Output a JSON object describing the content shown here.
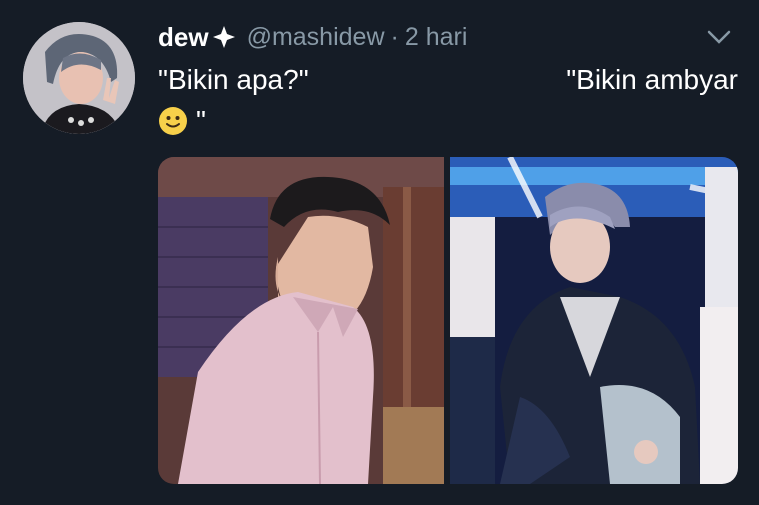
{
  "tweet": {
    "display_name": "dew",
    "verified_icon": "four-point-star-icon",
    "handle": "@mashidew",
    "separator": "·",
    "timestamp": "2 hari",
    "text_left": "\"Bikin apa?\"",
    "text_right": "\"Bikin ambyar",
    "text_end": "\"",
    "emoji": "slightly-smiling-face-icon",
    "more_icon": "chevron-down-icon"
  },
  "colors": {
    "background": "#151c26",
    "text_primary": "#ffffff",
    "text_secondary": "#8899a6"
  }
}
